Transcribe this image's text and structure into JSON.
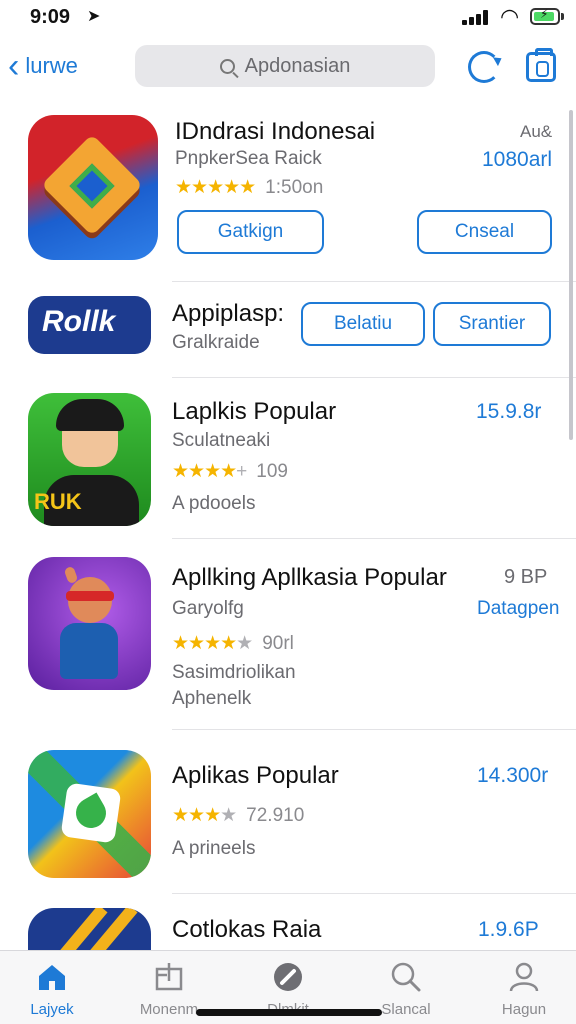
{
  "status_bar": {
    "time": "9:09",
    "location_icon": "location-arrow-icon",
    "signal_icon": "signal-icon",
    "wifi_icon": "wifi-icon",
    "battery_icon": "battery-charging-icon"
  },
  "nav": {
    "back_label": "lurwe",
    "search_value": "Apdonasian",
    "refresh_icon": "refresh-icon",
    "camera_icon": "camera-icon"
  },
  "apps": [
    {
      "title": "IDndrasi Indonesai",
      "subtitle": "PnpkerSea Raick",
      "rating_text": "1:50on",
      "meta": "Au&",
      "price": "1080arl",
      "buttons": [
        "Gatkign",
        "Cnseal"
      ],
      "colors": [
        "#d2232a",
        "#1b5fcf",
        "#f3a533"
      ]
    },
    {
      "title": "Appiplasp:",
      "subtitle": "Gralkraide",
      "logo_text": "Rollk",
      "buttons": [
        "Belatiu",
        "Srantier"
      ],
      "colors": [
        "#1d3b8f"
      ]
    },
    {
      "title": "Laplkis Popular",
      "subtitle": "Sculatneaki",
      "rating_count": "109",
      "note": "A pdooels",
      "price": "15.9.8r",
      "logo_text": "RUK",
      "colors": [
        "#2aa02a"
      ]
    },
    {
      "title": "Apllking Apllkasia Popular",
      "subtitle": "Garyolfg",
      "rating_count": "90rl",
      "note": "Sasimdriolikan",
      "note2": "Aphenelk",
      "meta": "9 BP",
      "price": "Datagpen",
      "colors": [
        "#6a2fb5"
      ]
    },
    {
      "title": "Aplikas Popular",
      "rating_count": "72.910",
      "note": "A prineels",
      "price": "14.300r",
      "colors": [
        "#1e8be0",
        "#f2c21a",
        "#e6443a"
      ]
    },
    {
      "title": "Cotlokas Raia",
      "price": "1.9.6P",
      "colors": [
        "#1d3b8f",
        "#f3b21b"
      ]
    }
  ],
  "tabbar": {
    "tabs": [
      {
        "label": "Lajyek",
        "icon": "home-icon"
      },
      {
        "label": "Monenm",
        "icon": "apps-icon"
      },
      {
        "label": "Dlmkit",
        "icon": "game-icon"
      },
      {
        "label": "Slancal",
        "icon": "search-icon"
      },
      {
        "label": "Hagun",
        "icon": "profile-icon"
      }
    ]
  }
}
